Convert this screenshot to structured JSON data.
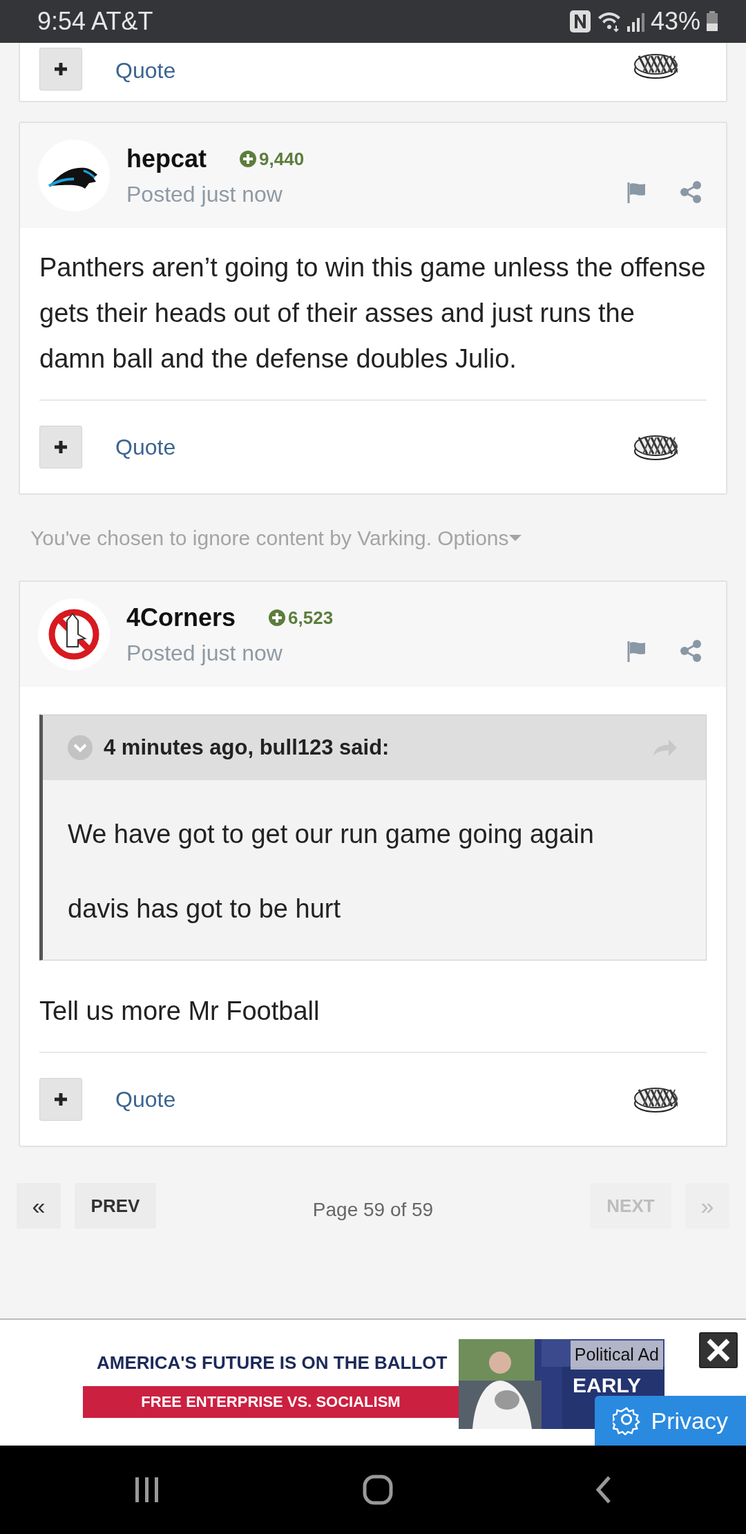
{
  "status_bar": {
    "time": "9:54 AT&T",
    "battery": "43%"
  },
  "posts": [
    {
      "kind": "partial",
      "quote_label": "Quote"
    },
    {
      "kind": "full",
      "avatar": {
        "kind": "cat"
      },
      "author": "hepcat",
      "reputation": "9,440",
      "posted": "Posted just now",
      "paragraphs": [
        "Panthers aren’t going to win this game unless the offense gets their heads out of their asses and just runs the damn ball and the defense doubles Julio."
      ],
      "quote_label": "Quote"
    },
    {
      "kind": "ignored",
      "text": "You've chosen to ignore content by Varking.",
      "options_label": "Options"
    },
    {
      "kind": "full",
      "avatar": {
        "kind": "prohibition"
      },
      "author": "4Corners",
      "reputation": "6,523",
      "posted": "Posted just now",
      "quote": {
        "header": "4 minutes ago, bull123 said:",
        "paragraphs": [
          "We have got to get our run game going again",
          "davis has got to be hurt"
        ]
      },
      "paragraphs": [
        "Tell us more Mr Football"
      ],
      "quote_label": "Quote"
    }
  ],
  "pagination": {
    "buttons": [
      {
        "label": "«",
        "disabled": false
      },
      {
        "label": "PREV",
        "disabled": false
      },
      {
        "label": "NEXT",
        "disabled": true
      },
      {
        "label": "»",
        "disabled": true
      }
    ],
    "page_info": "Page 59 of 59"
  },
  "ad": {
    "headline": "AMERICA'S FUTURE IS ON THE BALLOT",
    "tagline": "FREE ENTERPRISE VS. SOCIALISM",
    "label": "Political Ad",
    "overlay_word": "EARLY",
    "privacy": "Privacy"
  }
}
